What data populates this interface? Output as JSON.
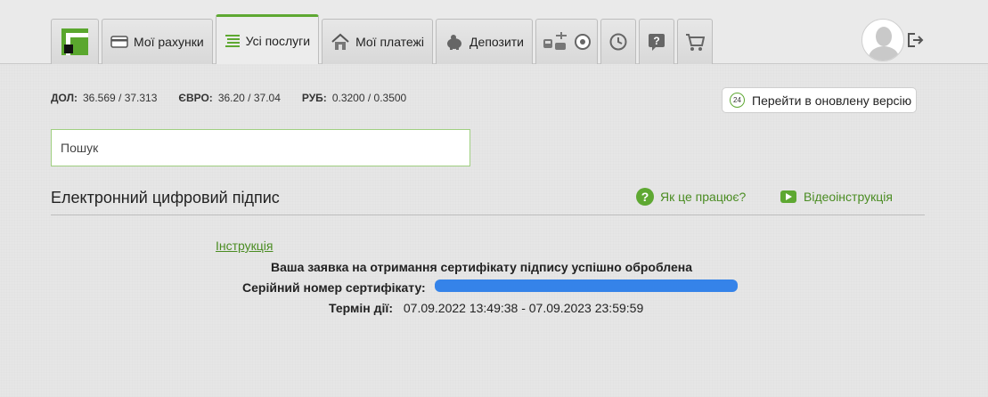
{
  "nav": {
    "tabs": [
      {
        "label": "Мої рахунки"
      },
      {
        "label": "Усі послуги"
      },
      {
        "label": "Мої платежі"
      },
      {
        "label": "Депозити"
      }
    ]
  },
  "rates": {
    "usd_label": "ДОЛ:",
    "usd_value": "36.569 / 37.313",
    "eur_label": "ЄВРО:",
    "eur_value": "36.20 / 37.04",
    "rub_label": "РУБ:",
    "rub_value": "0.3200 / 0.3500"
  },
  "new_version": {
    "badge": "24",
    "label": "Перейти в оновлену версію"
  },
  "search": {
    "placeholder": "Пошук"
  },
  "section": {
    "title": "Електронний цифровий підпис",
    "help_label": "Як це працює?",
    "video_label": "Відеоінструкція"
  },
  "content": {
    "instruction_link": "Інструкція",
    "success_message": "Ваша заявка на отримання сертифікату підпису успішно оброблена",
    "serial_label": "Серійний номер сертифікату:",
    "term_label": "Термін дії:",
    "term_value": "07.09.2022 13:49:38 - 07.09.2023 23:59:59"
  },
  "colors": {
    "accent": "#5ea832",
    "link": "#4a8c22",
    "redaction": "#2b7de9"
  }
}
